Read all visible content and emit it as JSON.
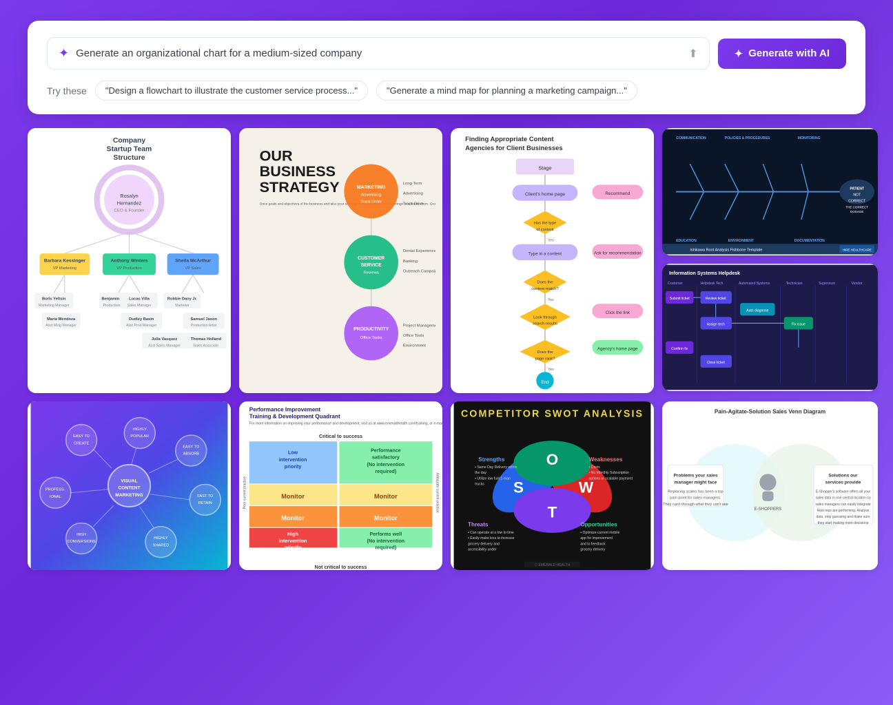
{
  "header": {
    "search_placeholder": "Generate an organizational chart for a medium-sized company",
    "generate_label": "Generate with AI",
    "try_label": "Try these",
    "suggestions": [
      "\"Design a flowchart to illustrate the customer service process...\"",
      "\"Generate a mind map for planning a marketing campaign...\""
    ]
  },
  "gallery": {
    "cards": [
      {
        "id": "org-chart",
        "title": "Company Startup Team Structure",
        "type": "org-chart"
      },
      {
        "id": "business-strategy",
        "title": "Our Business Strategy",
        "type": "strategy"
      },
      {
        "id": "content-agencies",
        "title": "Finding Appropriate Content Agencies for Client Businesses",
        "type": "flowchart"
      },
      {
        "id": "fishbone",
        "title": "Ishikawa Root Analysis Fishbone Template",
        "type": "fishbone"
      },
      {
        "id": "helpdesk",
        "title": "Information Systems Helpdesk",
        "type": "helpdesk"
      },
      {
        "id": "mindmap",
        "title": "Visual Content Marketing",
        "type": "mindmap"
      },
      {
        "id": "quadrant",
        "title": "Performance Improvement Training & Development Quadrant",
        "type": "quadrant"
      },
      {
        "id": "swot",
        "title": "Competitor SWOT Analysis",
        "type": "swot"
      },
      {
        "id": "venn",
        "title": "Pain-Agitate-Solution Sales Venn Diagram",
        "type": "venn"
      }
    ]
  }
}
